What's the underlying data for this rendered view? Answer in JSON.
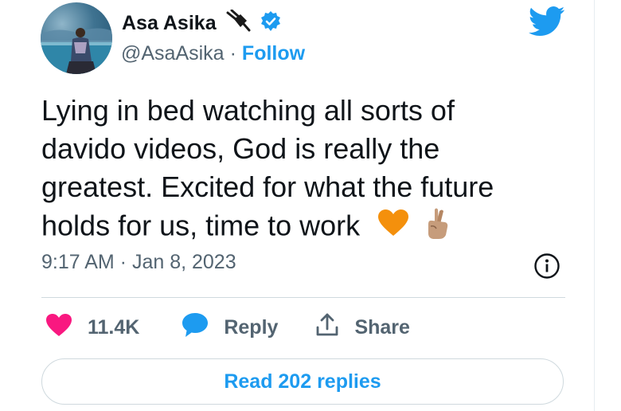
{
  "author": {
    "name": "Asa Asika",
    "handle": "@AsaAsika",
    "separator": "·",
    "follow_label": "Follow",
    "icons": [
      "electric-plug-icon",
      "verified-badge-icon"
    ]
  },
  "brand": {
    "logo": "twitter-bird-icon",
    "color": "#1d9bf0"
  },
  "tweet": {
    "lines": [
      "Lying in bed watching all sorts of",
      "davido videos, God is really the",
      "greatest. Excited for what the future",
      "holds for us, time to work"
    ],
    "emojis": [
      "orange-heart-icon",
      "crossed-fingers-icon"
    ],
    "timestamp": "9:17 AM · Jan 8, 2023"
  },
  "actions": {
    "like_count": "11.4K",
    "reply_label": "Reply",
    "share_label": "Share",
    "read_replies_label": "Read 202 replies"
  },
  "colors": {
    "text": "#0f1419",
    "secondary": "#536471",
    "accent": "#1d9bf0",
    "like": "#f91880",
    "heart_emoji": "#f4900c",
    "divider": "#cfd9de"
  }
}
